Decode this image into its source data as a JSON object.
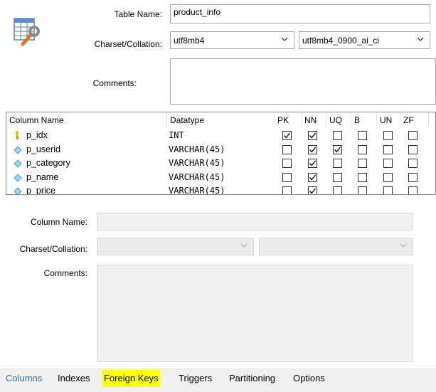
{
  "table": {
    "name_label": "Table Name:",
    "name_value": "product_info",
    "charset_label": "Charset/Collation:",
    "charset_value": "utf8mb4",
    "collation_value": "utf8mb4_0900_ai_ci",
    "comments_label": "Comments:",
    "comments_value": ""
  },
  "grid": {
    "headers": [
      "Column Name",
      "Datatype",
      "PK",
      "NN",
      "UQ",
      "B",
      "UN",
      "ZF"
    ],
    "rows": [
      {
        "name": "p_idx",
        "type": "INT",
        "icon": "primary-key-icon",
        "flags": [
          true,
          true,
          false,
          false,
          false,
          false
        ]
      },
      {
        "name": "p_userid",
        "type": "VARCHAR(45)",
        "icon": "column-diamond-icon",
        "flags": [
          false,
          true,
          true,
          false,
          false,
          false
        ]
      },
      {
        "name": "p_category",
        "type": "VARCHAR(45)",
        "icon": "column-diamond-icon",
        "flags": [
          false,
          true,
          false,
          false,
          false,
          false
        ]
      },
      {
        "name": "p_name",
        "type": "VARCHAR(45)",
        "icon": "column-diamond-icon",
        "flags": [
          false,
          true,
          false,
          false,
          false,
          false
        ]
      },
      {
        "name": "p_price",
        "type": "VARCHAR(45)",
        "icon": "column-diamond-icon",
        "flags": [
          false,
          true,
          false,
          false,
          false,
          false
        ]
      }
    ]
  },
  "column_detail": {
    "name_label": "Column Name:",
    "charset_label": "Charset/Collation:",
    "comments_label": "Comments:"
  },
  "tabs": [
    {
      "label": "Columns",
      "active": true
    },
    {
      "label": "Indexes",
      "active": false
    },
    {
      "label": "Foreign Keys",
      "active": false,
      "highlighted": true
    },
    {
      "label": "Triggers",
      "active": false
    },
    {
      "label": "Partitioning",
      "active": false
    },
    {
      "label": "Options",
      "active": false
    }
  ],
  "colors": {
    "active_tab": "#1f6fb7",
    "highlight": "#ffff00",
    "key_icon": "#f2b800",
    "diamond_icon": "#6fb7e6"
  }
}
